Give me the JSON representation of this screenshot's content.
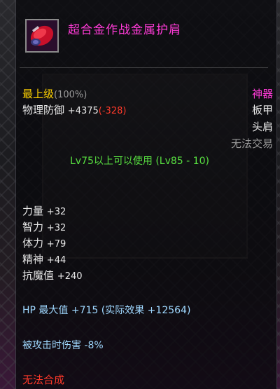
{
  "item": {
    "name": "超合金作战金属护肩",
    "grade_label": "最上级",
    "grade_percent": "(100%)",
    "rarity": "神器",
    "defense_label": "物理防御",
    "defense_value": "+4375",
    "defense_diff": "(-328)",
    "armor_type": "板甲",
    "slot": "头肩",
    "trade": "无法交易",
    "level_req": "Lv75以上可以使用 (Lv85 - 10)",
    "stats": [
      {
        "name": "力量",
        "value": "+32"
      },
      {
        "name": "智力",
        "value": "+32"
      },
      {
        "name": "体力",
        "value": "+79"
      },
      {
        "name": "精神",
        "value": "+44"
      },
      {
        "name": "抗魔值",
        "value": "+240"
      }
    ],
    "hp_line": "HP 最大值 +715 (实际效果 +12564)",
    "damage_line": "被攻击时伤害 -8%",
    "fusion": "无法合成"
  },
  "colors": {
    "rarity": "#ff3bd7",
    "grade": "#ffd200",
    "negative": "#ff3a2a",
    "requirement": "#58e040"
  },
  "icon": "red-shoulder-armor-icon"
}
